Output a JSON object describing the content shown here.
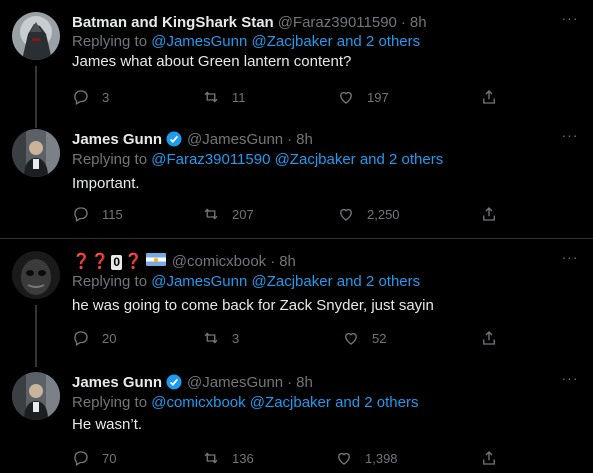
{
  "tweets": [
    {
      "name": "Batman and KingShark Stan",
      "handle": "@Faraz39011590",
      "separator": "·",
      "time": "8h",
      "replying_prefix": "Replying to",
      "replying_mentions": "@JamesGunn @Zacjbaker and 2 others",
      "text": "James what about Green lantern content?",
      "replies": "3",
      "retweets": "11",
      "likes": "197",
      "avatar_icon": "dark-knight-avatar"
    },
    {
      "name": "James Gunn",
      "verified": true,
      "handle": "@JamesGunn",
      "separator": "·",
      "time": "8h",
      "replying_prefix": "Replying to",
      "replying_mentions": "@Faraz39011590 @Zacjbaker and 2 others",
      "text": "Important.",
      "replies": "115",
      "retweets": "207",
      "likes": "2,250",
      "avatar_icon": "person-photo-avatar"
    },
    {
      "name_parts": [
        "❓",
        "❓",
        "0",
        "❓"
      ],
      "handle": "@comicxbook",
      "separator": "·",
      "time": "8h",
      "replying_prefix": "Replying to",
      "replying_mentions": "@JamesGunn @Zacjbaker and 2 others",
      "text": "he was going to come back for Zack Snyder, just sayin",
      "replies": "20",
      "retweets": "3",
      "likes": "52",
      "avatar_icon": "masked-face-avatar"
    },
    {
      "name": "James Gunn",
      "verified": true,
      "handle": "@JamesGunn",
      "separator": "·",
      "time": "8h",
      "replying_prefix": "Replying to",
      "replying_mentions": "@comicxbook @Zacjbaker and 2 others",
      "text": "He wasn’t.",
      "replies": "70",
      "retweets": "136",
      "likes": "1,398",
      "avatar_icon": "person-photo-avatar"
    }
  ],
  "more_glyph": "···",
  "colors": {
    "background": "#000000",
    "text": "#e7e9ea",
    "muted": "#71767b",
    "link": "#1d9bf0",
    "verified": "#1d9bf0",
    "divider": "#2f3336"
  }
}
